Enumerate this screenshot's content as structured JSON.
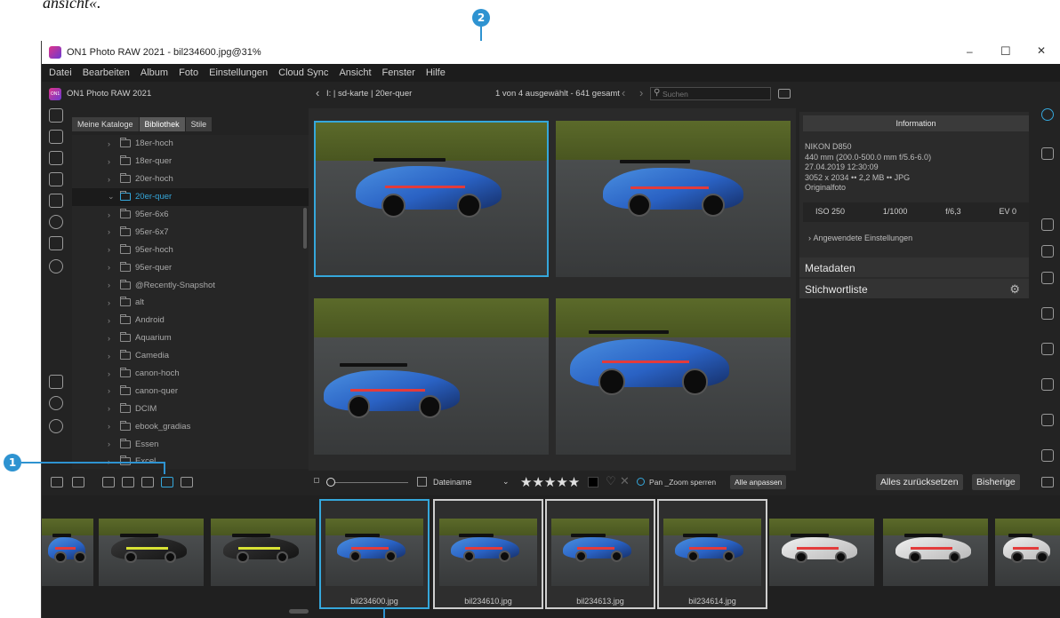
{
  "caption": "ansicht«.",
  "callouts": {
    "one": "1",
    "two": "2"
  },
  "colors": {
    "accent": "#35a7db",
    "callout": "#2e93d1",
    "bg": "#232323"
  },
  "window": {
    "title": "ON1 Photo RAW 2021 - bil234600.jpg@31%",
    "controls": [
      "–",
      "☐",
      "✕"
    ]
  },
  "menu": [
    "Datei",
    "Bearbeiten",
    "Album",
    "Foto",
    "Einstellungen",
    "Cloud Sync",
    "Ansicht",
    "Fenster",
    "Hilfe"
  ],
  "app_header": {
    "label": "ON1 Photo RAW 2021",
    "icon_text": "ON1"
  },
  "breadcrumb": "I: | sd-karte | 20er-quer",
  "selection_status": "1 von 4 ausgewählt - 641 gesamt",
  "search": {
    "placeholder": "Suchen"
  },
  "tabs": [
    "Meine Kataloge",
    "Bibliothek",
    "Stile"
  ],
  "folders": [
    "18er-hoch",
    "18er-quer",
    "20er-hoch",
    "20er-quer",
    "95er-6x6",
    "95er-6x7",
    "95er-hoch",
    "95er-quer",
    "@Recently-Snapshot",
    "alt",
    "Android",
    "Aquarium",
    "Camedia",
    "canon-hoch",
    "canon-quer",
    "DCIM",
    "ebook_gradias",
    "Essen",
    "Excel"
  ],
  "selected_folder_index": 3,
  "info": {
    "tab": "Information",
    "camera": "NIKON D850",
    "lens": "440 mm (200.0-500.0 mm f/5.6-6.0)",
    "date": "27.04.2019 12:30:09",
    "dims": "3052 x 2034 •• 2,2 MB •• JPG",
    "type": "Originalfoto",
    "iso": "ISO 250",
    "shutter": "1/1000",
    "aperture": "f/6,3",
    "ev": "EV 0",
    "applied": "Angewendete Einstellungen",
    "metadata": "Metadaten",
    "keywords": "Stichwortliste"
  },
  "bottom_bar": {
    "sort_label": "Dateiname",
    "stars": "★★★★★",
    "pan_zoom": "Pan _Zoom sperren",
    "fit_all": "Alle anpassen",
    "reset_all": "Alles zurücksetzen",
    "previous": "Bisherige"
  },
  "filmstrip": [
    {
      "name": "",
      "style": "blue",
      "boxed": false
    },
    {
      "name": "",
      "style": "dark",
      "boxed": false
    },
    {
      "name": "",
      "style": "dark",
      "boxed": false
    },
    {
      "name": "bil234600.jpg",
      "style": "blue",
      "boxed": true,
      "selected": true
    },
    {
      "name": "bil234610.jpg",
      "style": "blue",
      "boxed": true,
      "selected": false
    },
    {
      "name": "bil234613.jpg",
      "style": "blue",
      "boxed": true,
      "selected": false
    },
    {
      "name": "bil234614.jpg",
      "style": "blue",
      "boxed": true,
      "selected": false
    },
    {
      "name": "",
      "style": "white",
      "boxed": false
    },
    {
      "name": "",
      "style": "white",
      "boxed": false
    },
    {
      "name": "",
      "style": "white",
      "boxed": false
    }
  ],
  "icons": {
    "left_rail": [
      "plus-icon",
      "monitor-icon",
      "camera-icon",
      "folder-cloud-icon",
      "drive-icon",
      "cloud-icon",
      "albums-icon",
      "sun-icon",
      "plugin-icon",
      "user-icon",
      "help-icon"
    ],
    "right_rail": [
      "browse-icon",
      "develop-icon",
      "layers-icon",
      "effects-icon",
      "portrait-icon",
      "local-icon",
      "export-icon",
      "print-icon",
      "share-icon",
      "upload-icon"
    ]
  }
}
